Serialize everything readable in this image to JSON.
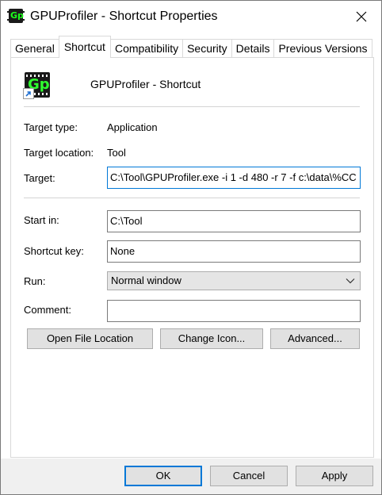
{
  "window": {
    "title": "GPUProfiler - Shortcut Properties",
    "icon": "gpuprofiler-icon",
    "close_icon": "close-icon"
  },
  "tabs": [
    {
      "label": "General",
      "active": false
    },
    {
      "label": "Shortcut",
      "active": true
    },
    {
      "label": "Compatibility",
      "active": false
    },
    {
      "label": "Security",
      "active": false
    },
    {
      "label": "Details",
      "active": false
    },
    {
      "label": "Previous Versions",
      "active": false
    }
  ],
  "shortcut": {
    "icon_text": "Gp",
    "name": "GPUProfiler - Shortcut",
    "target_type_label": "Target type:",
    "target_type_value": "Application",
    "target_location_label": "Target location:",
    "target_location_value": "Tool",
    "target_label": "Target:",
    "target_value": "C:\\Tool\\GPUProfiler.exe  -i 1 -d 480 -r 7 -f c:\\data\\%CC",
    "start_in_label": "Start in:",
    "start_in_value": "C:\\Tool",
    "shortcut_key_label": "Shortcut key:",
    "shortcut_key_value": "None",
    "run_label": "Run:",
    "run_value": "Normal window",
    "comment_label": "Comment:",
    "comment_value": ""
  },
  "actions": {
    "open_file_location": "Open File Location",
    "change_icon": "Change Icon...",
    "advanced": "Advanced..."
  },
  "footer": {
    "ok": "OK",
    "cancel": "Cancel",
    "apply": "Apply"
  },
  "colors": {
    "accent": "#0078d7",
    "button_face": "#e1e1e1",
    "icon_green": "#2fff2f"
  }
}
